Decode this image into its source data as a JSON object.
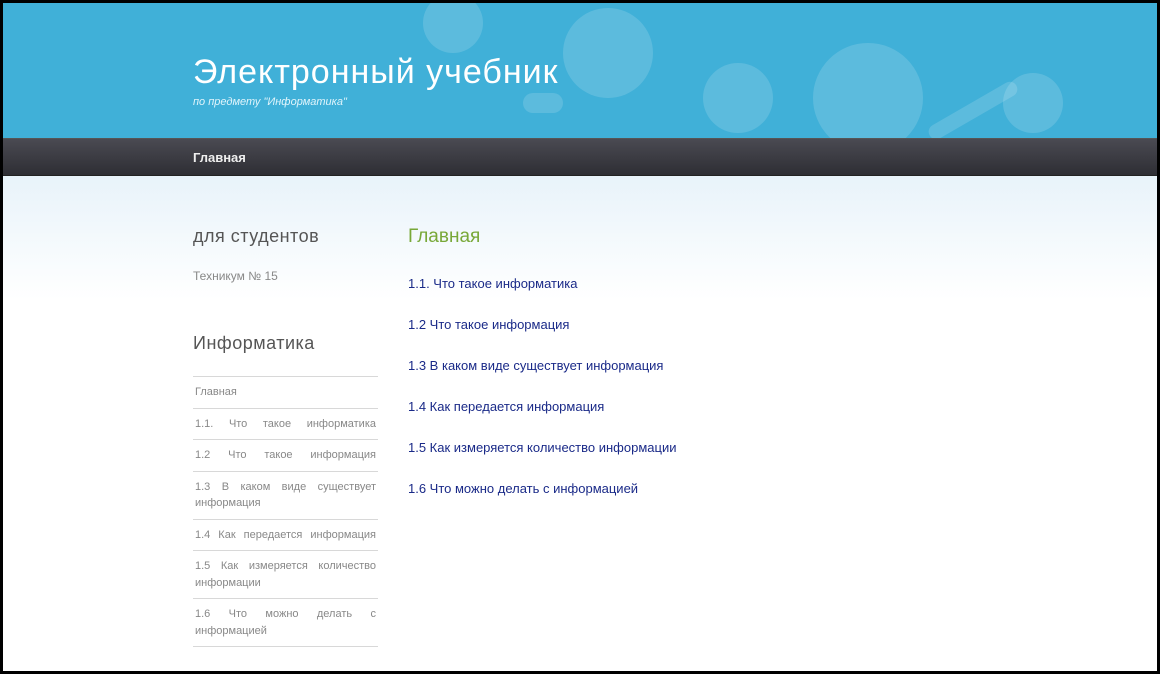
{
  "header": {
    "title": "Электронный учебник",
    "subtitle": "по предмету \"Информатика\""
  },
  "navbar": {
    "items": [
      {
        "label": "Главная"
      }
    ]
  },
  "sidebar": {
    "section1_title": "для студентов",
    "section1_text": "Техникум № 15",
    "section2_title": "Информатика",
    "menu": [
      {
        "label": "Главная"
      },
      {
        "label": "1.1. Что такое информатика"
      },
      {
        "label": "1.2 Что такое информация"
      },
      {
        "label": "1.3 В каком виде существует информация"
      },
      {
        "label": "1.4 Как передается информация"
      },
      {
        "label": "1.5 Как измеряется количество информации"
      },
      {
        "label": "1.6 Что можно делать с информацией"
      }
    ]
  },
  "main": {
    "title": "Главная",
    "links": [
      {
        "label": "1.1. Что такое информатика"
      },
      {
        "label": "1.2 Что такое информация"
      },
      {
        "label": "1.3 В каком виде существует информация"
      },
      {
        "label": "1.4 Как передается информация"
      },
      {
        "label": "1.5 Как измеряется количество информации"
      },
      {
        "label": "1.6 Что можно делать с информацией"
      }
    ]
  }
}
